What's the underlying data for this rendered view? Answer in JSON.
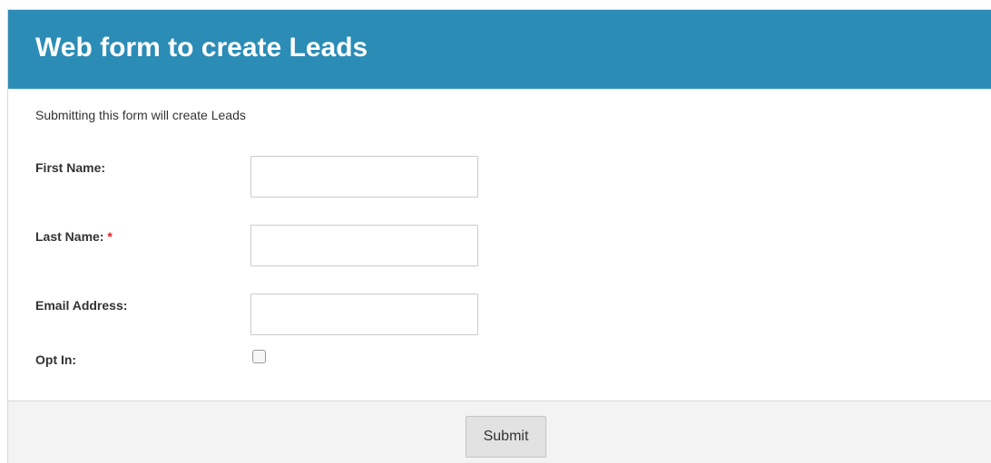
{
  "header": {
    "title": "Web form to create Leads"
  },
  "form": {
    "description": "Submitting this form will create Leads",
    "fields": {
      "first_name": {
        "label": "First Name:",
        "value": ""
      },
      "last_name": {
        "label": "Last Name:",
        "required_marker": "*",
        "value": ""
      },
      "email": {
        "label": "Email Address:",
        "value": ""
      },
      "opt_in": {
        "label": "Opt In:",
        "checked": false
      }
    },
    "submit_label": "Submit"
  },
  "colors": {
    "header_background": "#2b8cb6",
    "header_text": "#ffffff",
    "required": "#e02020",
    "footer_background": "#f3f3f3"
  }
}
